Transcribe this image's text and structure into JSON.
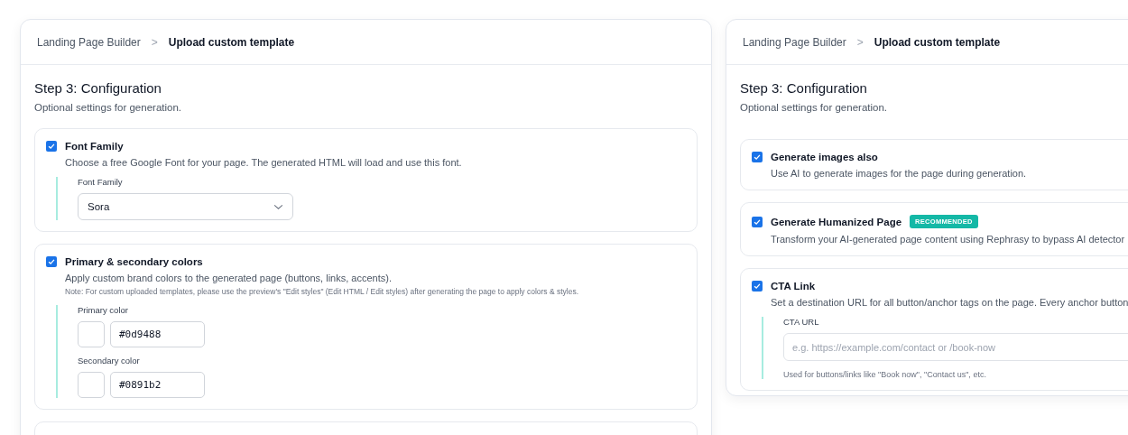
{
  "panels": [
    {
      "breadcrumb": {
        "parent": "Landing Page Builder",
        "separator": ">",
        "current": "Upload custom template"
      },
      "title": "Step 3: Configuration",
      "subtitle": "Optional settings for generation.",
      "options": [
        {
          "title": "Font Family",
          "checked": true,
          "description": "Choose a free Google Font for your page. The generated HTML will load and use this font.",
          "fields": [
            {
              "kind": "select",
              "label": "Font Family",
              "value": "Sora"
            }
          ]
        },
        {
          "title": "Primary & secondary colors",
          "checked": true,
          "description": "Apply custom brand colors to the generated page (buttons, links, accents).",
          "note": "Note: For custom uploaded templates, please use the preview's \"Edit styles\" (Edit HTML / Edit styles) after generating the page to apply colors & styles.",
          "fields": [
            {
              "kind": "color",
              "label": "Primary color",
              "value": "#0d9488"
            },
            {
              "kind": "color",
              "label": "Secondary color",
              "value": "#0891b2"
            }
          ]
        }
      ]
    },
    {
      "breadcrumb": {
        "parent": "Landing Page Builder",
        "separator": ">",
        "current": "Upload custom template"
      },
      "title": "Step 3: Configuration",
      "subtitle": "Optional settings for generation.",
      "options": [
        {
          "title": "Generate images also",
          "checked": true,
          "description": "Use AI to generate images for the page during generation."
        },
        {
          "title": "Generate Humanized Page",
          "checked": true,
          "badge": "RECOMMENDED",
          "description": "Transform your AI-generated page content using Rephrasy to bypass AI detector"
        },
        {
          "title": "CTA Link",
          "checked": true,
          "description": "Set a destination URL for all button/anchor tags on the page. Every anchor button",
          "fields": [
            {
              "kind": "text",
              "label": "CTA URL",
              "placeholder": "e.g. https://example.com/contact or /book-now",
              "help": "Used for buttons/links like \"Book now\", \"Contact us\", etc."
            }
          ]
        }
      ]
    }
  ]
}
